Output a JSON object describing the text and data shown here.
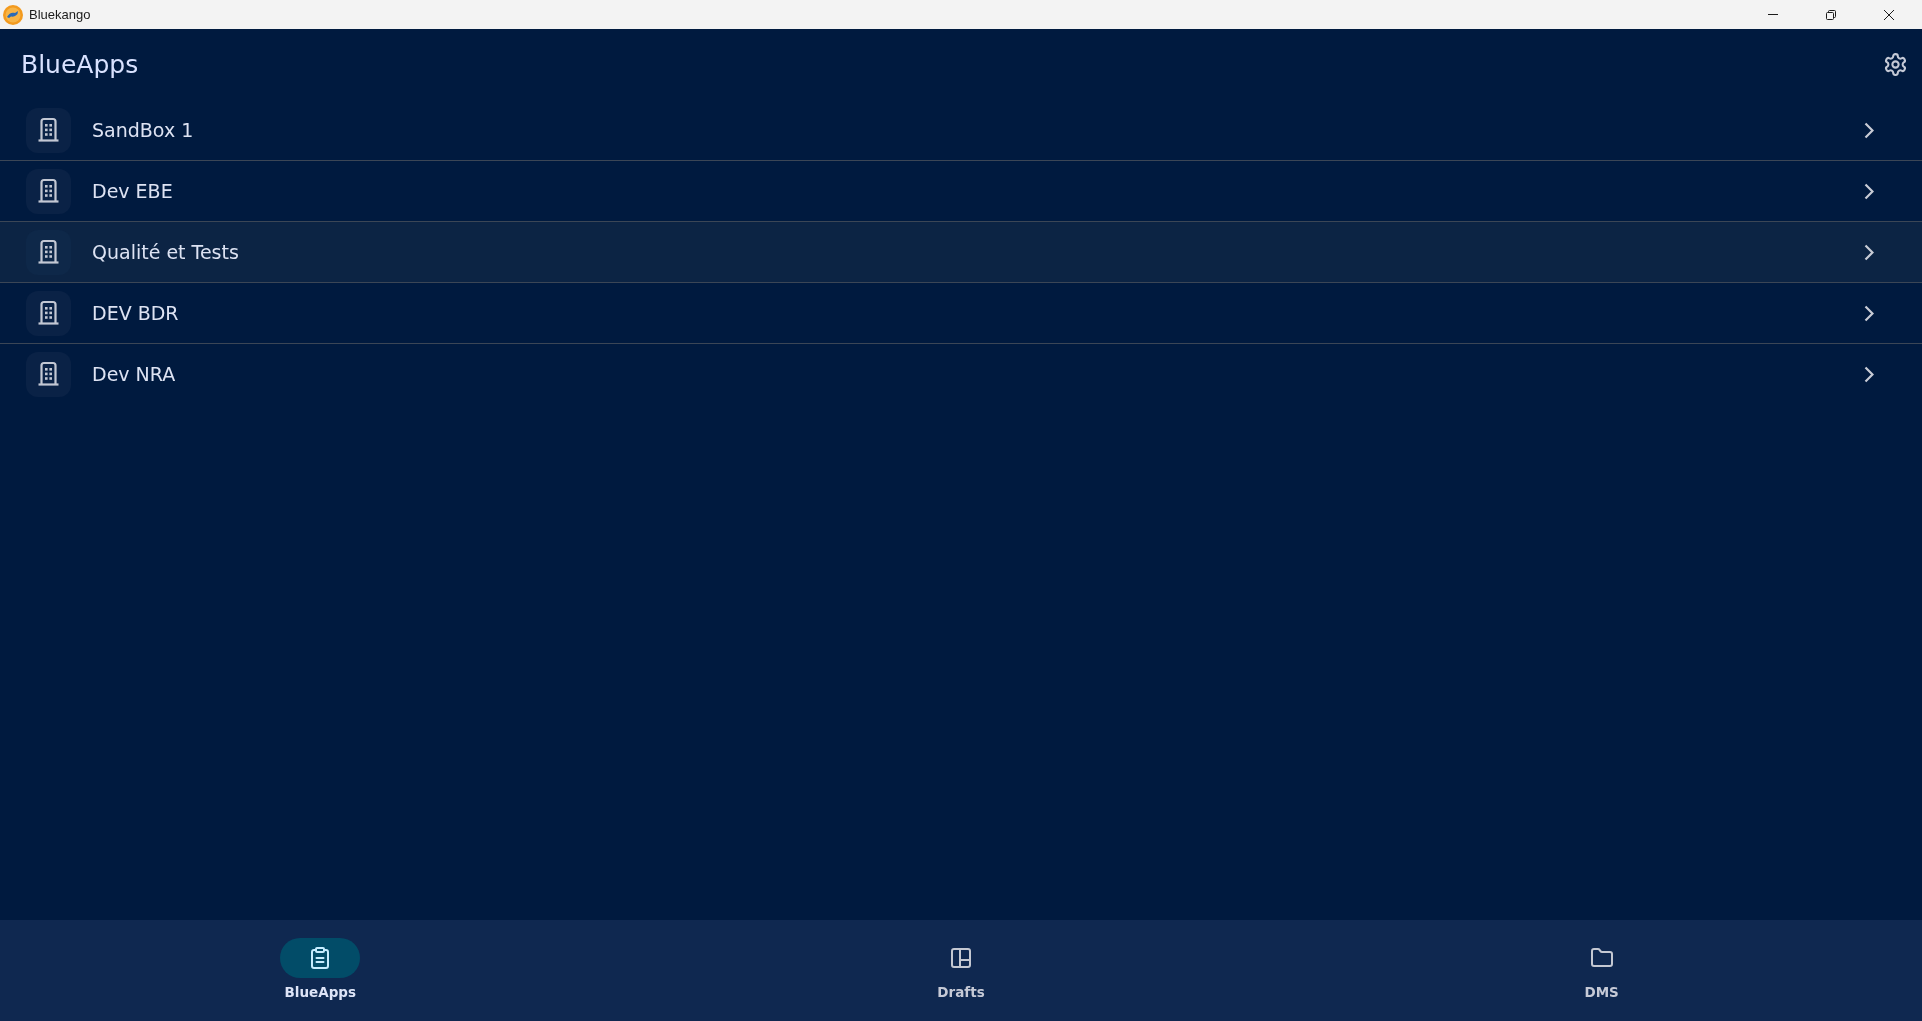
{
  "window": {
    "title": "Bluekango"
  },
  "header": {
    "title": "BlueApps"
  },
  "workspaces": [
    {
      "name": "SandBox 1",
      "selected": false
    },
    {
      "name": "Dev EBE",
      "selected": false
    },
    {
      "name": "Qualité et Tests",
      "selected": true
    },
    {
      "name": "DEV BDR",
      "selected": false
    },
    {
      "name": "Dev NRA",
      "selected": false
    }
  ],
  "bottom_nav": [
    {
      "label": "BlueApps",
      "selected": true
    },
    {
      "label": "Drafts",
      "selected": false
    },
    {
      "label": "DMS",
      "selected": false
    }
  ]
}
